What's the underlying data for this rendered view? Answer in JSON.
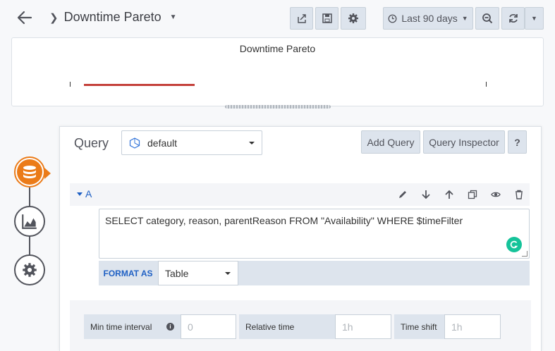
{
  "header": {
    "title": "Downtime Pareto",
    "time_range": "Last 90 days"
  },
  "panel": {
    "title": "Downtime Pareto"
  },
  "query_editor": {
    "label": "Query",
    "datasource": "default",
    "add_query": "Add Query",
    "query_inspector": "Query Inspector",
    "help": "?",
    "query": {
      "ref_id": "A",
      "sql": "SELECT category, reason, parentReason FROM \"Availability\" WHERE $timeFilter",
      "format_label": "FORMAT AS",
      "format_value": "Table"
    },
    "options": {
      "min_interval_label": "Min time interval",
      "min_interval_placeholder": "0",
      "relative_time_label": "Relative time",
      "relative_time_placeholder": "1h",
      "time_shift_label": "Time shift",
      "time_shift_placeholder": "1h"
    }
  },
  "colors": {
    "accent_orange": "#eb7b18",
    "link_blue": "#1f60c4",
    "series_red": "#c4403a"
  }
}
